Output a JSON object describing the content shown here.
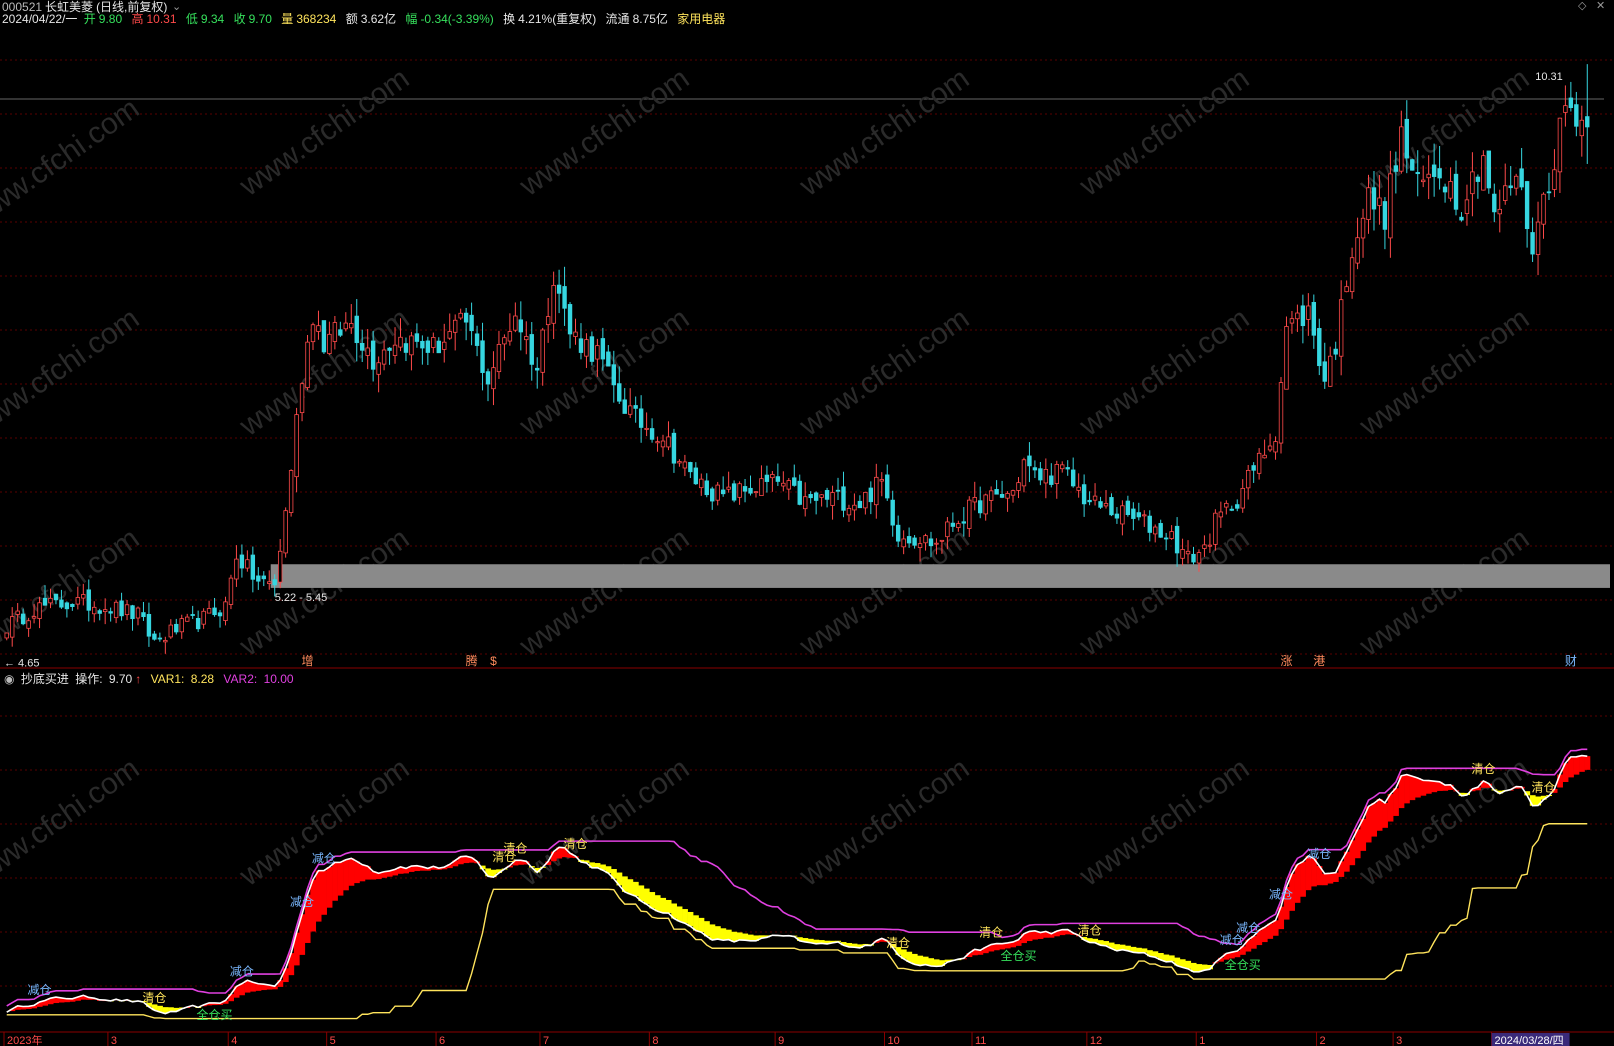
{
  "header": {
    "code": "000521",
    "name": "长虹美菱",
    "mode": "(日线,前复权)",
    "date": "2024/04/22/一",
    "open_label": "开",
    "open": "9.80",
    "high_label": "高",
    "high": "10.31",
    "low_label": "低",
    "low": "9.34",
    "close_label": "收",
    "close": "9.70",
    "vol_label": "量",
    "vol": "368234",
    "amt_label": "额",
    "amt": "3.62亿",
    "chg_label": "幅",
    "chg": "-0.34(-3.39%)",
    "turn_label": "换",
    "turn": "4.21%(重复权)",
    "float_label": "流通",
    "float": "8.75亿",
    "industry": "家用电器"
  },
  "price_labels": {
    "max": "10.31",
    "min": "4.65",
    "zone": "5.22 - 5.45"
  },
  "event_markers": [
    {
      "label": "增",
      "day": 55
    },
    {
      "label": "腾",
      "day": 85
    },
    {
      "label": "$",
      "day": 89
    },
    {
      "label": "涨",
      "day": 234
    },
    {
      "label": "港",
      "day": 240
    },
    {
      "label": "财",
      "day": 286
    }
  ],
  "indicator": {
    "name": "抄底买进",
    "op_label": "操作:",
    "op_value": "9.70",
    "var1_label": "VAR1:",
    "var1_value": "8.28",
    "var2_label": "VAR2:",
    "var2_value": "10.00"
  },
  "signals": [
    {
      "text": "减仓",
      "day": 6,
      "kind": "reduce"
    },
    {
      "text": "清仓",
      "day": 27,
      "kind": "clear"
    },
    {
      "text": "全仓买",
      "day": 38,
      "kind": "buy"
    },
    {
      "text": "减仓",
      "day": 43,
      "kind": "reduce"
    },
    {
      "text": "减仓",
      "day": 54,
      "kind": "reduce"
    },
    {
      "text": "减仓",
      "day": 58,
      "kind": "reduce"
    },
    {
      "text": "清仓",
      "day": 91,
      "kind": "clear"
    },
    {
      "text": "清仓",
      "day": 93,
      "kind": "clear"
    },
    {
      "text": "清仓",
      "day": 104,
      "kind": "clear"
    },
    {
      "text": "清仓",
      "day": 163,
      "kind": "clear"
    },
    {
      "text": "清仓",
      "day": 180,
      "kind": "clear"
    },
    {
      "text": "全仓买",
      "day": 185,
      "kind": "buy"
    },
    {
      "text": "清仓",
      "day": 198,
      "kind": "clear"
    },
    {
      "text": "减仓",
      "day": 224,
      "kind": "reduce"
    },
    {
      "text": "全仓买",
      "day": 226,
      "kind": "buy"
    },
    {
      "text": "减仓",
      "day": 227,
      "kind": "reduce"
    },
    {
      "text": "减仓",
      "day": 233,
      "kind": "reduce"
    },
    {
      "text": "减仓",
      "day": 240,
      "kind": "reduce"
    },
    {
      "text": "清仓",
      "day": 270,
      "kind": "clear"
    },
    {
      "text": "清仓",
      "day": 281,
      "kind": "clear"
    }
  ],
  "time_axis": [
    {
      "label": "2023年",
      "day": 0
    },
    {
      "label": "3",
      "day": 19
    },
    {
      "label": "4",
      "day": 41
    },
    {
      "label": "5",
      "day": 59
    },
    {
      "label": "6",
      "day": 79
    },
    {
      "label": "7",
      "day": 98
    },
    {
      "label": "8",
      "day": 118
    },
    {
      "label": "9",
      "day": 141
    },
    {
      "label": "10",
      "day": 161
    },
    {
      "label": "11",
      "day": 177
    },
    {
      "label": "12",
      "day": 198
    },
    {
      "label": "1",
      "day": 218
    },
    {
      "label": "2",
      "day": 240
    },
    {
      "label": "3",
      "day": 254
    },
    {
      "label": "2024/03/28/四",
      "day": 272
    }
  ],
  "colors": {
    "up": "#ff4a4a",
    "down": "#36d6e0",
    "grid": "#5a0000",
    "zone": "#8a8a8a",
    "var1": "#ffe45c",
    "var2": "#e040e0",
    "ma": "#ffffff",
    "band_up": "#ff0000",
    "band_down": "#ffff00",
    "reduce": "#7ab8ff",
    "clear": "#ffe45c",
    "buy": "#36e05c"
  },
  "chart_data": {
    "type": "candlestick",
    "days": 290,
    "y_range": [
      4.5,
      10.7
    ],
    "anchors": [
      [
        0,
        4.85
      ],
      [
        5,
        5.02
      ],
      [
        12,
        5.08
      ],
      [
        18,
        5.05
      ],
      [
        24,
        4.95
      ],
      [
        27,
        4.7
      ],
      [
        31,
        4.82
      ],
      [
        36,
        4.92
      ],
      [
        40,
        5.05
      ],
      [
        42,
        5.55
      ],
      [
        44,
        5.4
      ],
      [
        46,
        5.28
      ],
      [
        49,
        5.25
      ],
      [
        51,
        5.95
      ],
      [
        54,
        7.3
      ],
      [
        56,
        7.9
      ],
      [
        58,
        7.6
      ],
      [
        63,
        7.8
      ],
      [
        67,
        7.45
      ],
      [
        71,
        7.65
      ],
      [
        78,
        7.55
      ],
      [
        84,
        7.8
      ],
      [
        88,
        7.25
      ],
      [
        93,
        7.9
      ],
      [
        97,
        7.35
      ],
      [
        100,
        8.3
      ],
      [
        103,
        7.7
      ],
      [
        108,
        7.5
      ],
      [
        111,
        7.15
      ],
      [
        115,
        6.85
      ],
      [
        120,
        6.7
      ],
      [
        125,
        6.3
      ],
      [
        131,
        6.1
      ],
      [
        137,
        6.2
      ],
      [
        141,
        6.25
      ],
      [
        146,
        6.05
      ],
      [
        151,
        6.1
      ],
      [
        156,
        6.05
      ],
      [
        160,
        6.25
      ],
      [
        163,
        5.75
      ],
      [
        167,
        5.7
      ],
      [
        170,
        5.65
      ],
      [
        173,
        5.85
      ],
      [
        178,
        6.05
      ],
      [
        184,
        6.15
      ],
      [
        186,
        6.45
      ],
      [
        188,
        6.3
      ],
      [
        193,
        6.35
      ],
      [
        198,
        6.05
      ],
      [
        203,
        5.95
      ],
      [
        208,
        5.85
      ],
      [
        213,
        5.72
      ],
      [
        216,
        5.5
      ],
      [
        219,
        5.6
      ],
      [
        221,
        5.85
      ],
      [
        225,
        6.1
      ],
      [
        229,
        6.45
      ],
      [
        232,
        6.75
      ],
      [
        234,
        7.75
      ],
      [
        238,
        7.9
      ],
      [
        241,
        7.25
      ],
      [
        243,
        7.6
      ],
      [
        246,
        8.55
      ],
      [
        249,
        9.0
      ],
      [
        252,
        8.85
      ],
      [
        255,
        9.6
      ],
      [
        258,
        9.1
      ],
      [
        262,
        9.3
      ],
      [
        266,
        8.95
      ],
      [
        270,
        9.45
      ],
      [
        272,
        8.8
      ],
      [
        276,
        9.25
      ],
      [
        279,
        8.55
      ],
      [
        282,
        9.2
      ],
      [
        285,
        9.9
      ],
      [
        287,
        9.85
      ],
      [
        289,
        9.7
      ]
    ],
    "last_bar": {
      "open": 9.8,
      "high": 10.31,
      "low": 9.34,
      "close": 9.7
    },
    "indicator": {
      "series": [
        "操作",
        "VAR1",
        "VAR2"
      ],
      "last": {
        "操作": 9.7,
        "VAR1": 8.28,
        "VAR2": 10.0
      }
    }
  }
}
